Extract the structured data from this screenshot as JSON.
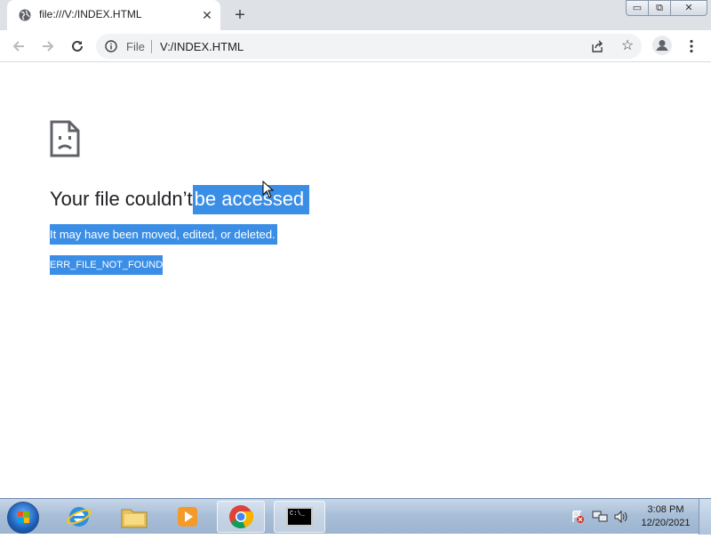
{
  "browser": {
    "tab": {
      "title": "file:///V:/INDEX.HTML",
      "close_label": "✕"
    },
    "new_tab_label": "+",
    "omnibox": {
      "scheme_label": "File",
      "url": "V:/INDEX.HTML"
    },
    "window_controls": {
      "minimize": "▭",
      "maximize": "⧉",
      "close": "✕"
    }
  },
  "error_page": {
    "icon": "sad-file-icon",
    "headline_plain": "Your file couldn’t",
    "headline_selected": "be accessed",
    "message": "It may have been moved, edited, or deleted.",
    "error_code": "ERR_FILE_NOT_FOUND"
  },
  "taskbar": {
    "pinned": [
      {
        "name": "internet-explorer-icon"
      },
      {
        "name": "file-explorer-icon"
      },
      {
        "name": "media-player-icon"
      },
      {
        "name": "chrome-icon"
      },
      {
        "name": "command-prompt-icon"
      }
    ],
    "clock": {
      "time": "3:08 PM",
      "date": "12/20/2021"
    },
    "cmd_label": "C:\\_"
  },
  "colors": {
    "selection": "#3a8ee6",
    "tab_strip": "#dee1e6",
    "taskbar": "#a9bfd8"
  }
}
